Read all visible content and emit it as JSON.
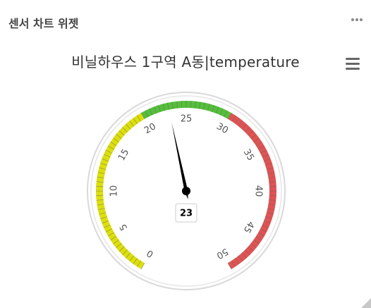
{
  "widget": {
    "title": "센서 차트 위젯"
  },
  "chart": {
    "title": "비닐하우스 1구역 A동|temperature"
  },
  "chart_data": {
    "type": "gauge",
    "title": "비닐하우스 1구역 A동|temperature",
    "value": 23,
    "min": 0,
    "max": 50,
    "tick_labels": [
      "0",
      "5",
      "10",
      "15",
      "20",
      "25",
      "30",
      "35",
      "40",
      "45",
      "50"
    ],
    "bands": [
      {
        "from": 0,
        "to": 20,
        "color": "#DDDF0D"
      },
      {
        "from": 20,
        "to": 30,
        "color": "#55BF3B"
      },
      {
        "from": 30,
        "to": 50,
        "color": "#DF5353"
      }
    ]
  }
}
